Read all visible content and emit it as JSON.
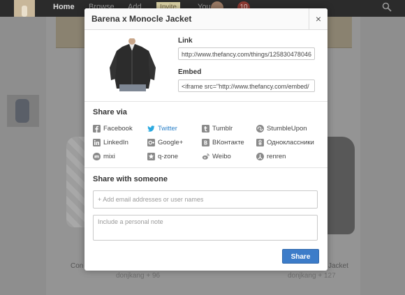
{
  "background": {
    "nav": [
      "Home",
      "Browse",
      "Add",
      "Invite",
      "You"
    ],
    "notifications": "10",
    "captions": {
      "left": "Con",
      "left_user": "donjkang + 96",
      "right": "Jacket",
      "right_user": "donjkang + 127"
    }
  },
  "modal": {
    "title": "Barena x Monocle Jacket",
    "close_symbol": "×",
    "link_label": "Link",
    "link_value": "http://www.thefancy.com/things/125830478046",
    "embed_label": "Embed",
    "embed_value": "<iframe src=\"http://www.thefancy.com/embed/",
    "share_via_title": "Share via",
    "share_via": [
      {
        "label": "Facebook",
        "icon": "facebook-icon",
        "color": "#3b5998"
      },
      {
        "label": "Twitter",
        "icon": "twitter-icon",
        "color": "#2aa9e0"
      },
      {
        "label": "Tumblr",
        "icon": "tumblr-icon",
        "color": "#8a8a8a"
      },
      {
        "label": "StumbleUpon",
        "icon": "stumbleupon-icon",
        "color": "#8a8a8a"
      },
      {
        "label": "LinkedIn",
        "icon": "linkedin-icon",
        "color": "#8a8a8a"
      },
      {
        "label": "Google+",
        "icon": "googleplus-icon",
        "color": "#8a8a8a"
      },
      {
        "label": "ВКонтакте",
        "icon": "vkontakte-icon",
        "color": "#8a8a8a"
      },
      {
        "label": "Одноклассники",
        "icon": "odnoklassniki-icon",
        "color": "#8a8a8a"
      },
      {
        "label": "mixi",
        "icon": "mixi-icon",
        "color": "#8a8a8a"
      },
      {
        "label": "q-zone",
        "icon": "qzone-icon",
        "color": "#8a8a8a"
      },
      {
        "label": "Weibo",
        "icon": "weibo-icon",
        "color": "#8a8a8a"
      },
      {
        "label": "renren",
        "icon": "renren-icon",
        "color": "#8a8a8a"
      }
    ],
    "share_with_title": "Share with someone",
    "email_placeholder": "+ Add email addresses or user names",
    "note_placeholder": "Include a personal note",
    "share_button": "Share"
  },
  "colors": {
    "accent": "#3c7cc9",
    "twitter_text": "#2a80c8"
  }
}
